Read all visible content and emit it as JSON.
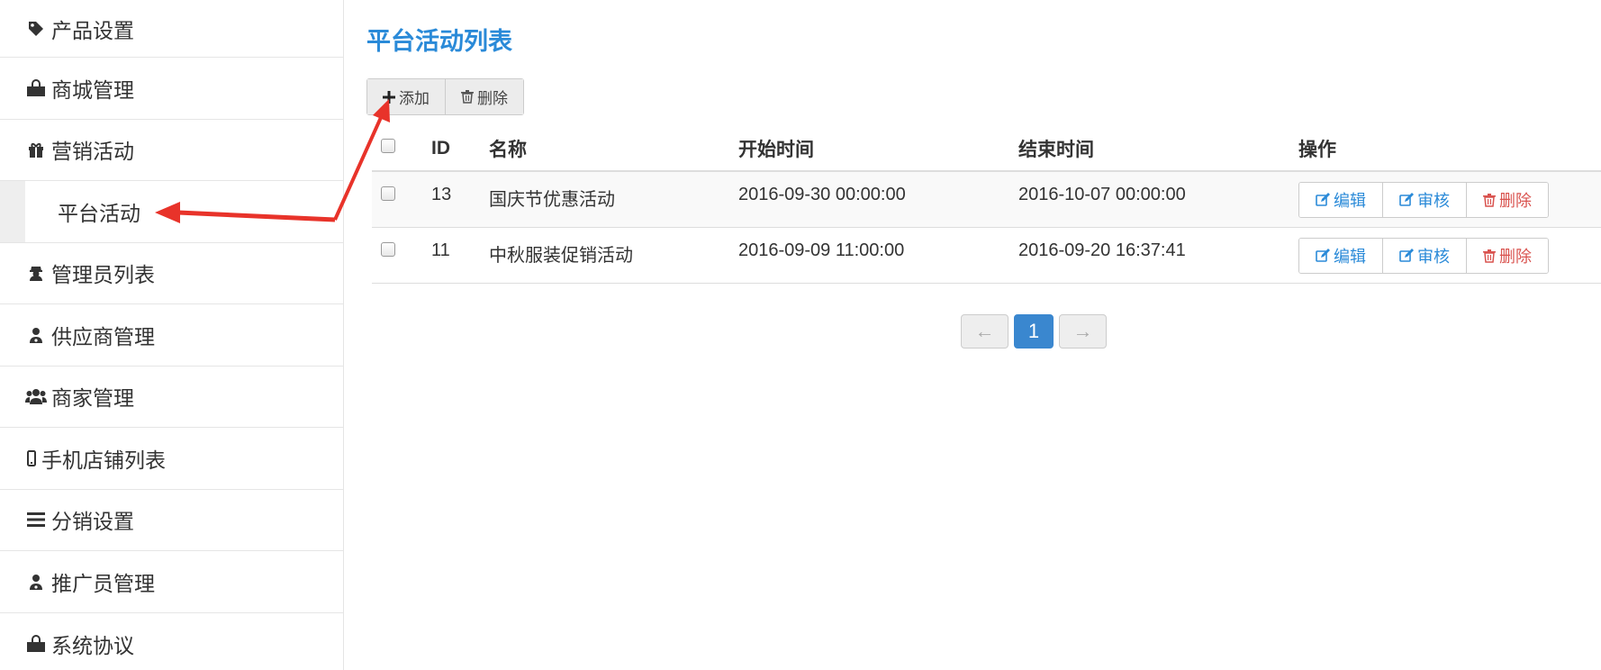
{
  "sidebar": {
    "items": [
      {
        "label": "产品设置",
        "icon": "tag-icon"
      },
      {
        "label": "商城管理",
        "icon": "shopping-bag-icon"
      },
      {
        "label": "营销活动",
        "icon": "gift-icon"
      },
      {
        "label": "平台活动",
        "icon": "",
        "sub": true
      },
      {
        "label": "管理员列表",
        "icon": "user-secret-icon"
      },
      {
        "label": "供应商管理",
        "icon": "user-md-icon"
      },
      {
        "label": "商家管理",
        "icon": "users-icon"
      },
      {
        "label": "手机店铺列表",
        "icon": "mobile-icon"
      },
      {
        "label": "分销设置",
        "icon": "bars-icon"
      },
      {
        "label": "推广员管理",
        "icon": "user-md-icon"
      },
      {
        "label": "系统协议",
        "icon": "shopping-bag-icon"
      }
    ]
  },
  "page": {
    "title": "平台活动列表"
  },
  "toolbar": {
    "add_label": "添加",
    "delete_label": "删除"
  },
  "table": {
    "headers": {
      "id": "ID",
      "name": "名称",
      "start": "开始时间",
      "end": "结束时间",
      "ops": "操作"
    },
    "rows": [
      {
        "id": "13",
        "name": "国庆节优惠活动",
        "start": "2016-09-30 00:00:00",
        "end": "2016-10-07 00:00:00"
      },
      {
        "id": "11",
        "name": "中秋服装促销活动",
        "start": "2016-09-09 11:00:00",
        "end": "2016-09-20 16:37:41"
      }
    ],
    "actions": {
      "edit": "编辑",
      "review": "审核",
      "delete": "删除"
    }
  },
  "pagination": {
    "prev": "←",
    "current": "1",
    "next": "→"
  },
  "colors": {
    "accent": "#2a8ad8",
    "danger": "#d9534f",
    "arrow": "#e8332a"
  }
}
